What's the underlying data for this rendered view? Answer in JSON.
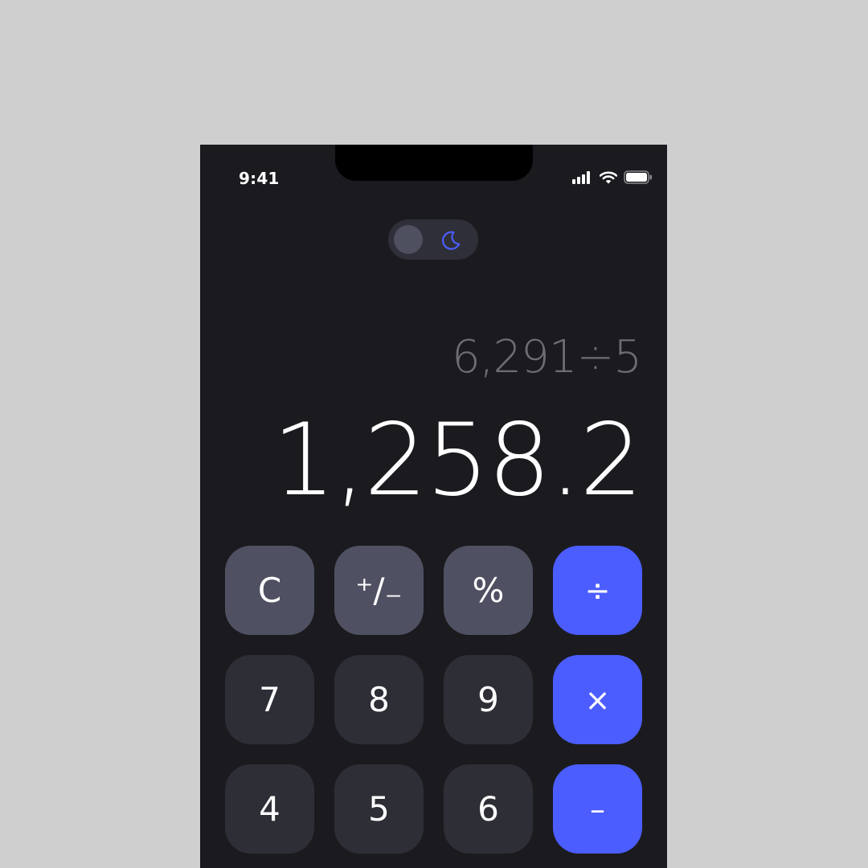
{
  "status_bar": {
    "time": "9:41",
    "icons": [
      "cellular-signal-icon",
      "wifi-icon",
      "battery-icon"
    ]
  },
  "theme_toggle": {
    "mode": "dark",
    "icon": "moon-icon"
  },
  "display": {
    "expression": "6,291÷5",
    "result": "1,258.2"
  },
  "keypad": {
    "rows": [
      [
        {
          "label": "C",
          "kind": "func",
          "name": "clear-button"
        },
        {
          "label": "⁺∕₋",
          "kind": "func",
          "name": "plus-minus-button"
        },
        {
          "label": "%",
          "kind": "func",
          "name": "percent-button"
        },
        {
          "label": "÷",
          "kind": "op",
          "name": "divide-button"
        }
      ],
      [
        {
          "label": "7",
          "kind": "num",
          "name": "digit-7-button"
        },
        {
          "label": "8",
          "kind": "num",
          "name": "digit-8-button"
        },
        {
          "label": "9",
          "kind": "num",
          "name": "digit-9-button"
        },
        {
          "label": "×",
          "kind": "op",
          "name": "multiply-button"
        }
      ],
      [
        {
          "label": "4",
          "kind": "num",
          "name": "digit-4-button"
        },
        {
          "label": "5",
          "kind": "num",
          "name": "digit-5-button"
        },
        {
          "label": "6",
          "kind": "num",
          "name": "digit-6-button"
        },
        {
          "label": "–",
          "kind": "op",
          "name": "subtract-button"
        }
      ]
    ]
  },
  "colors": {
    "page_background": "#cfcfcf",
    "app_background": "#1b1b1f",
    "function_key": "#4f5162",
    "number_key": "#2e2e37",
    "operator_key": "#4b5dff",
    "accent_moon": "#4b5dff",
    "expression_text": "#6d6d75",
    "result_text": "#ffffff"
  }
}
